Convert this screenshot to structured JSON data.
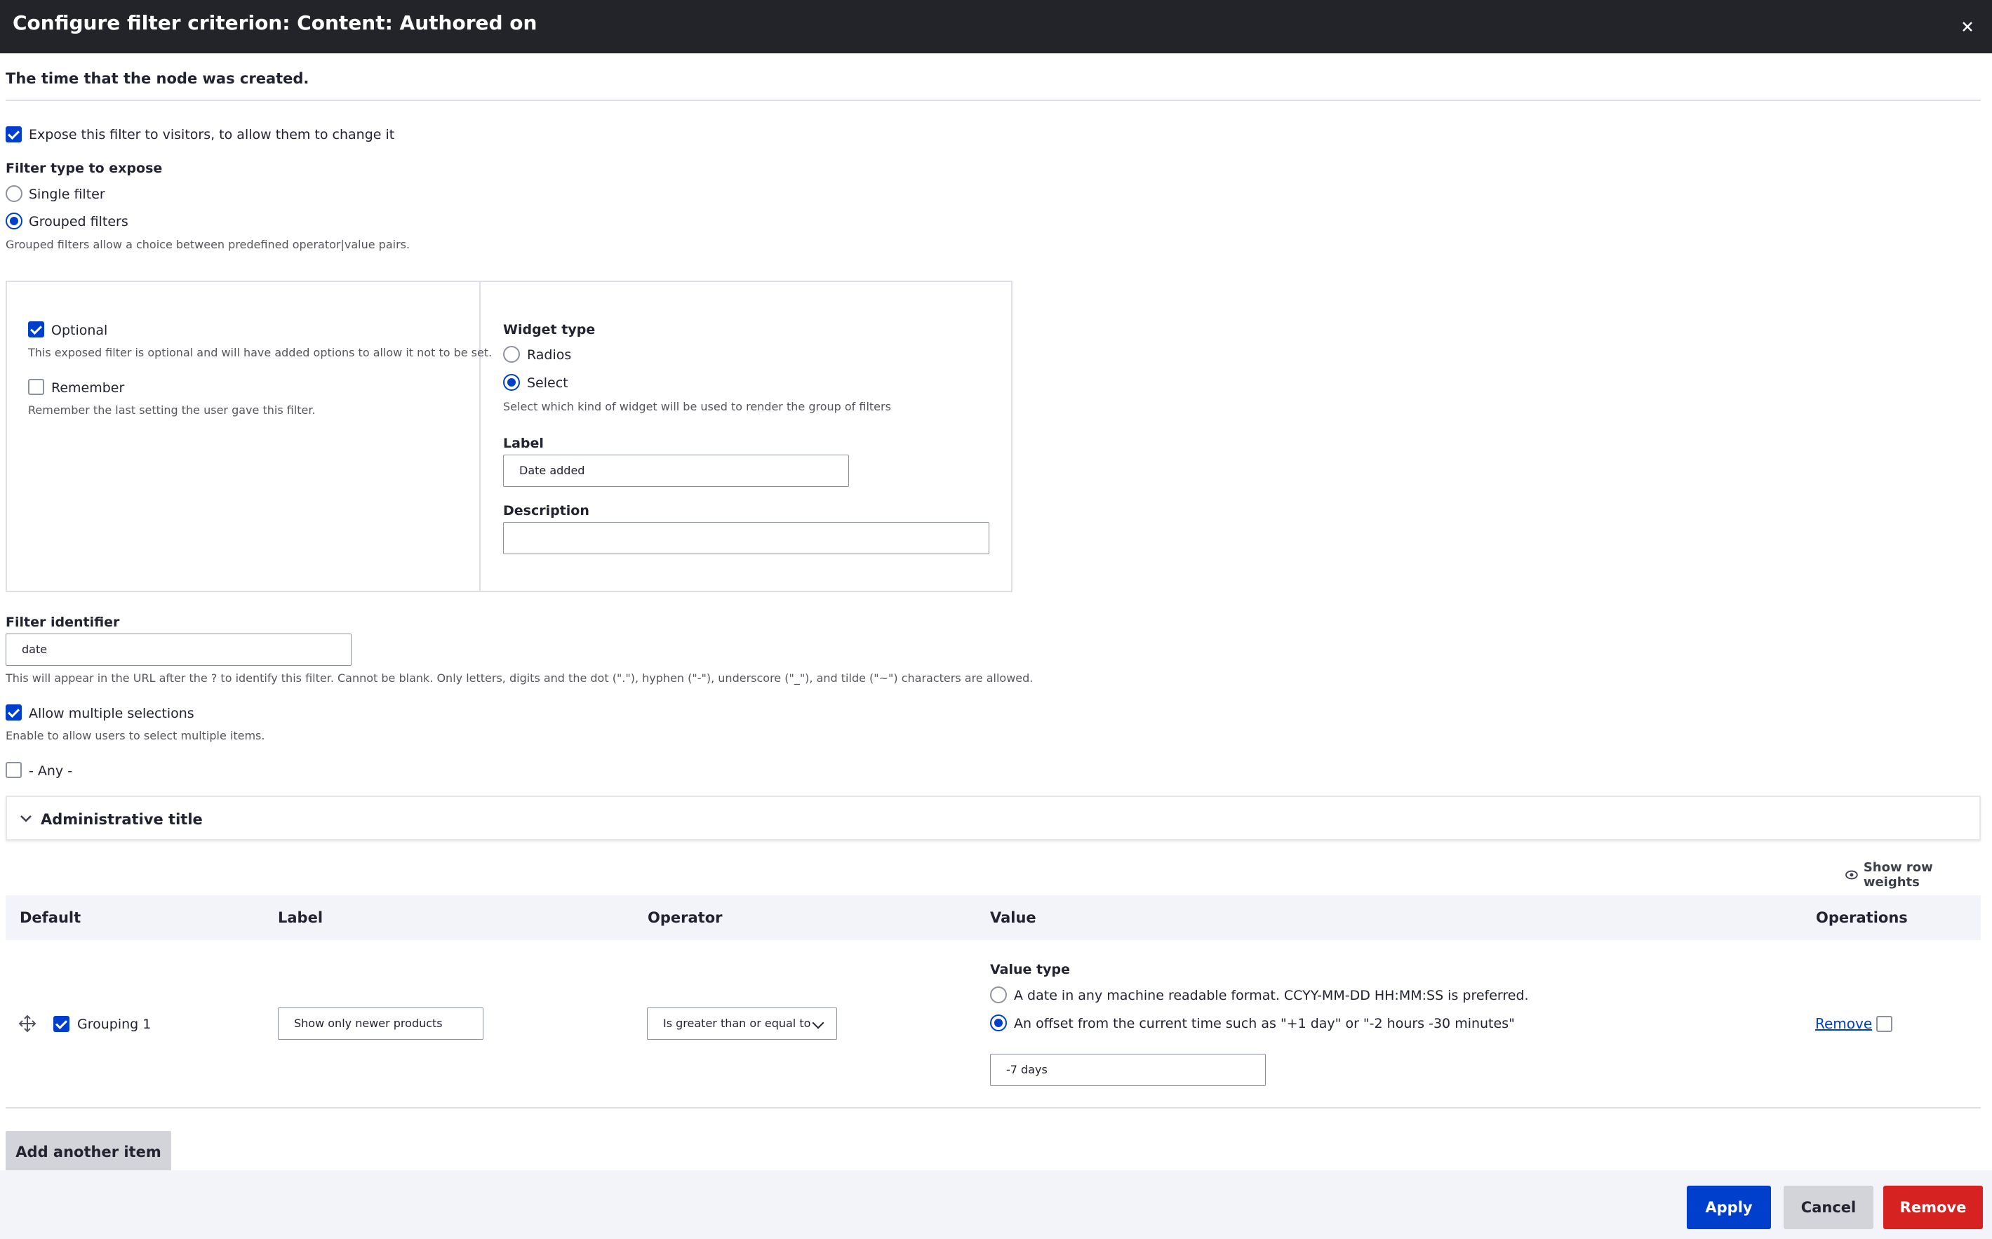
{
  "dialog": {
    "title": "Configure filter criterion: Content: Authored on",
    "description": "The time that the node was created."
  },
  "expose": {
    "checked": true,
    "label": "Expose this filter to visitors, to allow them to change it"
  },
  "filter_type": {
    "heading": "Filter type to expose",
    "options": [
      {
        "label": "Single filter",
        "selected": false
      },
      {
        "label": "Grouped filters",
        "selected": true
      }
    ],
    "help": "Grouped filters allow a choice between predefined operator|value pairs."
  },
  "options_panel": {
    "optional": {
      "label": "Optional",
      "checked": true,
      "help": "This exposed filter is optional and will have added options to allow it not to be set."
    },
    "remember": {
      "label": "Remember",
      "checked": false,
      "help": "Remember the last setting the user gave this filter."
    }
  },
  "widget": {
    "heading": "Widget type",
    "options": [
      {
        "label": "Radios",
        "selected": false
      },
      {
        "label": "Select",
        "selected": true
      }
    ],
    "help": "Select which kind of widget will be used to render the group of filters",
    "label_heading": "Label",
    "label_value": "Date added",
    "description_heading": "Description",
    "description_value": ""
  },
  "identifier": {
    "heading": "Filter identifier",
    "value": "date",
    "help": "This will appear in the URL after the ? to identify this filter. Cannot be blank. Only letters, digits and the dot (\".\"), hyphen (\"-\"), underscore (\"_\"), and tilde (\"~\") characters are allowed."
  },
  "multiple": {
    "label": "Allow multiple selections",
    "checked": true,
    "help": "Enable to allow users to select multiple items."
  },
  "any": {
    "label": "- Any -",
    "checked": false
  },
  "admin_title": {
    "label": "Administrative title"
  },
  "show_weights": "Show row weights",
  "table": {
    "headers": {
      "default": "Default",
      "label": "Label",
      "operator": "Operator",
      "value": "Value",
      "operations": "Operations"
    },
    "rows": [
      {
        "checked": true,
        "name": "Grouping 1",
        "label_value": "Show only newer products",
        "operator": "Is greater than or equal to",
        "value_type_heading": "Value type",
        "value_type_options": [
          {
            "label": "A date in any machine readable format. CCYY-MM-DD HH:MM:SS is preferred.",
            "selected": false
          },
          {
            "label": "An offset from the current time such as \"+1 day\" or \"-2 hours -30 minutes\"",
            "selected": true
          }
        ],
        "value": "-7 days",
        "remove_label": "Remove"
      }
    ]
  },
  "add_item": "Add another item",
  "footer": {
    "apply": "Apply",
    "cancel": "Cancel",
    "remove": "Remove"
  },
  "colors": {
    "accent": "#003ecc",
    "danger": "#d72222",
    "header_bg": "#232429"
  }
}
